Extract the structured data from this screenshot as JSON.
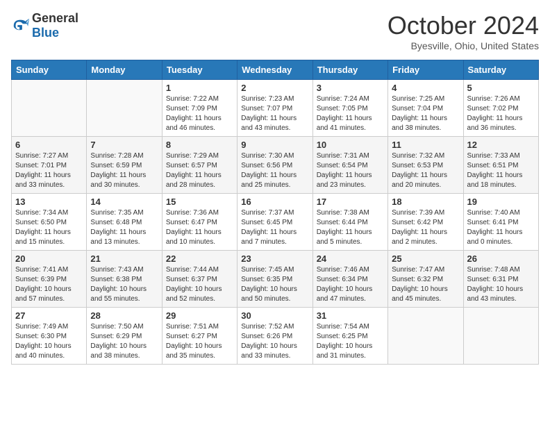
{
  "header": {
    "logo_general": "General",
    "logo_blue": "Blue",
    "month_title": "October 2024",
    "location": "Byesville, Ohio, United States"
  },
  "days_of_week": [
    "Sunday",
    "Monday",
    "Tuesday",
    "Wednesday",
    "Thursday",
    "Friday",
    "Saturday"
  ],
  "weeks": [
    [
      {
        "day": "",
        "info": ""
      },
      {
        "day": "",
        "info": ""
      },
      {
        "day": "1",
        "info": "Sunrise: 7:22 AM\nSunset: 7:09 PM\nDaylight: 11 hours and 46 minutes."
      },
      {
        "day": "2",
        "info": "Sunrise: 7:23 AM\nSunset: 7:07 PM\nDaylight: 11 hours and 43 minutes."
      },
      {
        "day": "3",
        "info": "Sunrise: 7:24 AM\nSunset: 7:05 PM\nDaylight: 11 hours and 41 minutes."
      },
      {
        "day": "4",
        "info": "Sunrise: 7:25 AM\nSunset: 7:04 PM\nDaylight: 11 hours and 38 minutes."
      },
      {
        "day": "5",
        "info": "Sunrise: 7:26 AM\nSunset: 7:02 PM\nDaylight: 11 hours and 36 minutes."
      }
    ],
    [
      {
        "day": "6",
        "info": "Sunrise: 7:27 AM\nSunset: 7:01 PM\nDaylight: 11 hours and 33 minutes."
      },
      {
        "day": "7",
        "info": "Sunrise: 7:28 AM\nSunset: 6:59 PM\nDaylight: 11 hours and 30 minutes."
      },
      {
        "day": "8",
        "info": "Sunrise: 7:29 AM\nSunset: 6:57 PM\nDaylight: 11 hours and 28 minutes."
      },
      {
        "day": "9",
        "info": "Sunrise: 7:30 AM\nSunset: 6:56 PM\nDaylight: 11 hours and 25 minutes."
      },
      {
        "day": "10",
        "info": "Sunrise: 7:31 AM\nSunset: 6:54 PM\nDaylight: 11 hours and 23 minutes."
      },
      {
        "day": "11",
        "info": "Sunrise: 7:32 AM\nSunset: 6:53 PM\nDaylight: 11 hours and 20 minutes."
      },
      {
        "day": "12",
        "info": "Sunrise: 7:33 AM\nSunset: 6:51 PM\nDaylight: 11 hours and 18 minutes."
      }
    ],
    [
      {
        "day": "13",
        "info": "Sunrise: 7:34 AM\nSunset: 6:50 PM\nDaylight: 11 hours and 15 minutes."
      },
      {
        "day": "14",
        "info": "Sunrise: 7:35 AM\nSunset: 6:48 PM\nDaylight: 11 hours and 13 minutes."
      },
      {
        "day": "15",
        "info": "Sunrise: 7:36 AM\nSunset: 6:47 PM\nDaylight: 11 hours and 10 minutes."
      },
      {
        "day": "16",
        "info": "Sunrise: 7:37 AM\nSunset: 6:45 PM\nDaylight: 11 hours and 7 minutes."
      },
      {
        "day": "17",
        "info": "Sunrise: 7:38 AM\nSunset: 6:44 PM\nDaylight: 11 hours and 5 minutes."
      },
      {
        "day": "18",
        "info": "Sunrise: 7:39 AM\nSunset: 6:42 PM\nDaylight: 11 hours and 2 minutes."
      },
      {
        "day": "19",
        "info": "Sunrise: 7:40 AM\nSunset: 6:41 PM\nDaylight: 11 hours and 0 minutes."
      }
    ],
    [
      {
        "day": "20",
        "info": "Sunrise: 7:41 AM\nSunset: 6:39 PM\nDaylight: 10 hours and 57 minutes."
      },
      {
        "day": "21",
        "info": "Sunrise: 7:43 AM\nSunset: 6:38 PM\nDaylight: 10 hours and 55 minutes."
      },
      {
        "day": "22",
        "info": "Sunrise: 7:44 AM\nSunset: 6:37 PM\nDaylight: 10 hours and 52 minutes."
      },
      {
        "day": "23",
        "info": "Sunrise: 7:45 AM\nSunset: 6:35 PM\nDaylight: 10 hours and 50 minutes."
      },
      {
        "day": "24",
        "info": "Sunrise: 7:46 AM\nSunset: 6:34 PM\nDaylight: 10 hours and 47 minutes."
      },
      {
        "day": "25",
        "info": "Sunrise: 7:47 AM\nSunset: 6:32 PM\nDaylight: 10 hours and 45 minutes."
      },
      {
        "day": "26",
        "info": "Sunrise: 7:48 AM\nSunset: 6:31 PM\nDaylight: 10 hours and 43 minutes."
      }
    ],
    [
      {
        "day": "27",
        "info": "Sunrise: 7:49 AM\nSunset: 6:30 PM\nDaylight: 10 hours and 40 minutes."
      },
      {
        "day": "28",
        "info": "Sunrise: 7:50 AM\nSunset: 6:29 PM\nDaylight: 10 hours and 38 minutes."
      },
      {
        "day": "29",
        "info": "Sunrise: 7:51 AM\nSunset: 6:27 PM\nDaylight: 10 hours and 35 minutes."
      },
      {
        "day": "30",
        "info": "Sunrise: 7:52 AM\nSunset: 6:26 PM\nDaylight: 10 hours and 33 minutes."
      },
      {
        "day": "31",
        "info": "Sunrise: 7:54 AM\nSunset: 6:25 PM\nDaylight: 10 hours and 31 minutes."
      },
      {
        "day": "",
        "info": ""
      },
      {
        "day": "",
        "info": ""
      }
    ]
  ]
}
